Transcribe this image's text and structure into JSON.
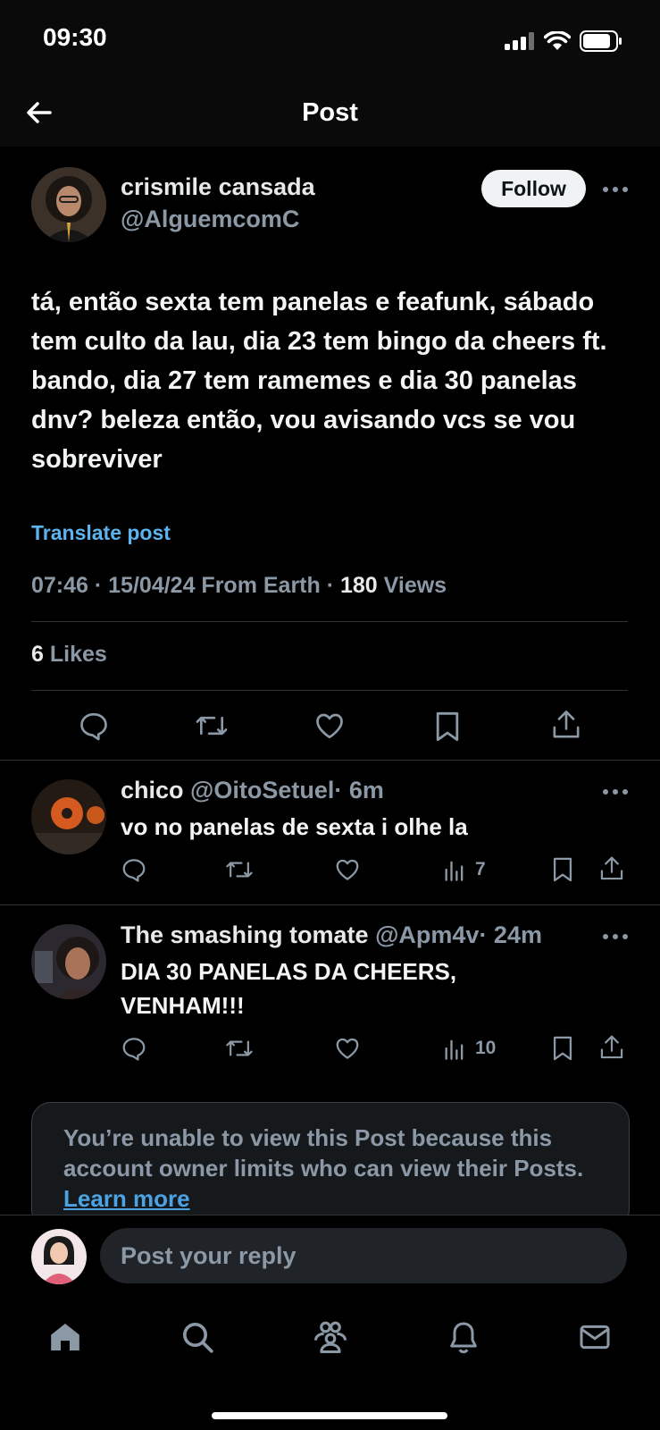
{
  "status": {
    "time": "09:30"
  },
  "header": {
    "title": "Post"
  },
  "tweet": {
    "author_name": "crismile cansada",
    "author_handle": "@AlguemcomC",
    "follow_label": "Follow",
    "text": "tá, então sexta tem panelas e feafunk, sábado tem culto da lau, dia 23 tem bingo da cheers ft. bando, dia 27 tem ramemes e dia 30 panelas dnv? beleza então, vou avisando vcs se vou sobreviver",
    "translate_label": "Translate post",
    "timestamp": "07:46 · 15/04/24 From Earth · ",
    "views_count": "180",
    "views_label": " Views",
    "likes_count": "6",
    "likes_label": " Likes"
  },
  "replies": [
    {
      "name": "chico",
      "handle": "@OitoSetuel",
      "age": "· 6m",
      "text": "vo no panelas de sexta i olhe la",
      "views": "7"
    },
    {
      "name": "The smashing tomate",
      "handle": "@Apm4v",
      "age": "· 24m",
      "text": "DIA 30 PANELAS DA CHEERS, VENHAM!!!",
      "views": "10"
    }
  ],
  "limited_notice": {
    "text": "You’re unable to view this Post because this account owner limits who can view their Posts. ",
    "link": "Learn more"
  },
  "composer": {
    "placeholder": "Post your reply"
  },
  "tabs": [
    "home-icon",
    "search-icon",
    "communities-icon",
    "notifications-icon",
    "messages-icon"
  ],
  "colors": {
    "accent": "#1d9bf0",
    "link": "#5bb3ef",
    "muted": "#8b98a5",
    "background": "#000000"
  }
}
